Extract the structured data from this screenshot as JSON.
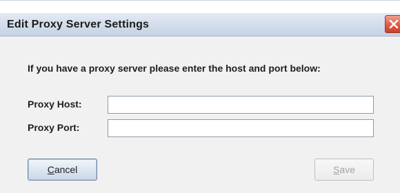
{
  "window": {
    "title": "Edit Proxy Server Settings",
    "close_icon": "close-x-icon",
    "close_color": "#d9513c"
  },
  "dialog": {
    "instruction": "If you have a proxy server please enter the host and port below:",
    "fields": [
      {
        "label": "Proxy Host:",
        "value": "",
        "placeholder": ""
      },
      {
        "label": "Proxy Port:",
        "value": "",
        "placeholder": ""
      }
    ]
  },
  "buttons": {
    "cancel": {
      "mnemonic": "C",
      "rest": "ancel",
      "enabled": true
    },
    "save": {
      "mnemonic": "S",
      "rest": "ave",
      "enabled": false
    }
  }
}
